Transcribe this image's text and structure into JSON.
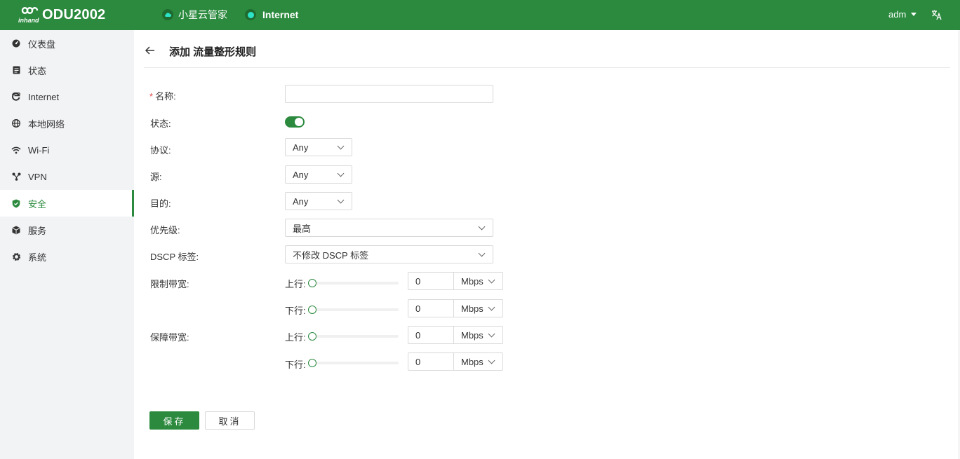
{
  "header": {
    "logo_text": "ODU2002",
    "logo_sub": "inhand",
    "cloud_label": "小星云管家",
    "internet_label": "Internet",
    "user": "adm",
    "colors": {
      "primary": "#2b8a3e",
      "badge": "#1f6b2f",
      "status_dot": "#2de3c7"
    }
  },
  "sidebar": {
    "items": [
      {
        "label": "仪表盘",
        "icon": "dashboard-icon"
      },
      {
        "label": "状态",
        "icon": "status-icon"
      },
      {
        "label": "Internet",
        "icon": "internet-icon"
      },
      {
        "label": "本地网络",
        "icon": "globe-icon"
      },
      {
        "label": "Wi-Fi",
        "icon": "wifi-icon"
      },
      {
        "label": "VPN",
        "icon": "vpn-icon"
      },
      {
        "label": "安全",
        "icon": "shield-icon",
        "active": true
      },
      {
        "label": "服务",
        "icon": "cube-icon"
      },
      {
        "label": "系统",
        "icon": "gear-icon"
      }
    ]
  },
  "page": {
    "title": "添加 流量整形规则"
  },
  "form": {
    "name": {
      "label": "名称:",
      "required_mark": "*",
      "value": ""
    },
    "status": {
      "label": "状态:",
      "enabled": true
    },
    "protocol": {
      "label": "协议:",
      "value": "Any"
    },
    "source": {
      "label": "源:",
      "value": "Any"
    },
    "destination": {
      "label": "目的:",
      "value": "Any"
    },
    "priority": {
      "label": "优先级:",
      "value": "最高"
    },
    "dscp": {
      "label": "DSCP 标签:",
      "value": "不修改 DSCP 标签"
    },
    "limit_bw": {
      "label": "限制带宽:",
      "up": {
        "label": "上行:",
        "value": "0",
        "unit": "Mbps",
        "slider_fraction": 0
      },
      "down": {
        "label": "下行:",
        "value": "0",
        "unit": "Mbps",
        "slider_fraction": 0
      }
    },
    "guarantee_bw": {
      "label": "保障带宽:",
      "up": {
        "label": "上行:",
        "value": "0",
        "unit": "Mbps",
        "slider_fraction": 0
      },
      "down": {
        "label": "下行:",
        "value": "0",
        "unit": "Mbps",
        "slider_fraction": 0
      }
    }
  },
  "buttons": {
    "save": "保存",
    "cancel": "取消"
  }
}
